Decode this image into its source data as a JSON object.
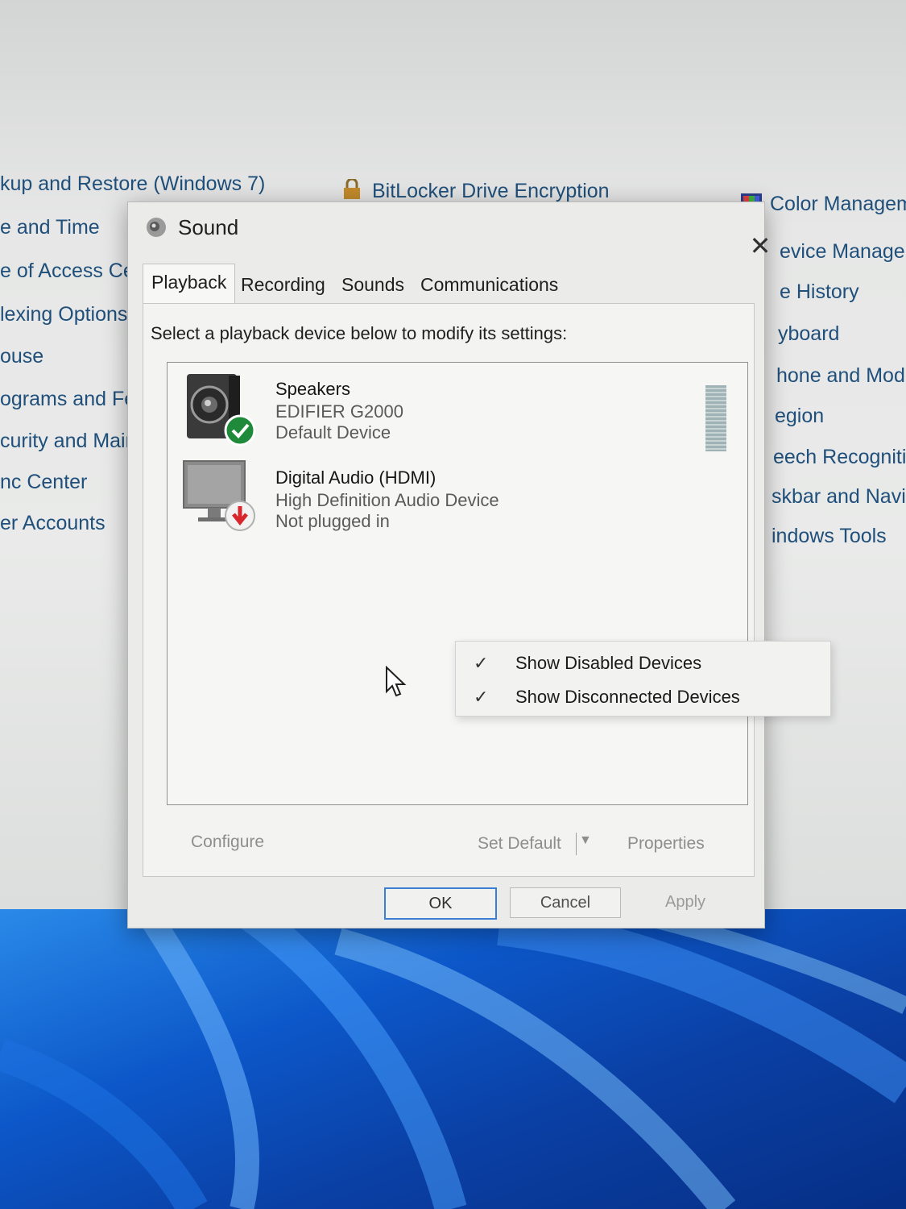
{
  "control_panel": {
    "items": [
      {
        "label": "kup and Restore (Windows 7)"
      },
      {
        "label": "BitLocker Drive Encryption"
      },
      {
        "label": "Color Managem"
      },
      {
        "label": "e and Time"
      },
      {
        "label": "evice Manager"
      },
      {
        "label": "e of Access Ce"
      },
      {
        "label": "e History"
      },
      {
        "label": "lexing Options"
      },
      {
        "label": "yboard"
      },
      {
        "label": "ouse"
      },
      {
        "label": "hone and Mode"
      },
      {
        "label": "ograms and Fea"
      },
      {
        "label": "egion"
      },
      {
        "label": "curity and Main"
      },
      {
        "label": "eech Recognitio"
      },
      {
        "label": "nc Center"
      },
      {
        "label": "skbar and Naviga"
      },
      {
        "label": "er Accounts"
      },
      {
        "label": "indows Tools"
      }
    ]
  },
  "dialog": {
    "title": "Sound",
    "close_glyph": "✕",
    "tabs": [
      {
        "label": "Playback"
      },
      {
        "label": "Recording"
      },
      {
        "label": "Sounds"
      },
      {
        "label": "Communications"
      }
    ],
    "instruction": "Select a playback device below to modify its settings:",
    "devices": [
      {
        "name": "Speakers",
        "description": "EDIFIER G2000",
        "status": "Default Device"
      },
      {
        "name": "Digital Audio (HDMI)",
        "description": "High Definition Audio Device",
        "status": "Not plugged in"
      }
    ],
    "context_menu": [
      {
        "check": "✓",
        "label": "Show Disabled Devices"
      },
      {
        "check": "✓",
        "label": "Show Disconnected Devices"
      }
    ],
    "buttons": {
      "configure": "Configure",
      "set_default": "Set Default",
      "properties": "Properties",
      "ok": "OK",
      "cancel": "Cancel",
      "apply": "Apply"
    }
  },
  "colors": {
    "link_text": "#1f4f7a",
    "default_badge": "#1e8a3a",
    "unplugged_badge": "#d8262c",
    "ok_focus": "#3b7ed6"
  }
}
